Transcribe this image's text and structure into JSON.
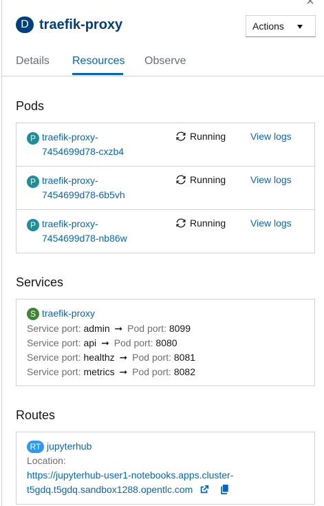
{
  "header": {
    "badge": "D",
    "title": "traefik-proxy",
    "actions_label": "Actions",
    "close_glyph": "×"
  },
  "tabs": [
    {
      "label": "Details",
      "active": false
    },
    {
      "label": "Resources",
      "active": true
    },
    {
      "label": "Observe",
      "active": false
    }
  ],
  "pods": {
    "title": "Pods",
    "items": [
      {
        "badge": "P",
        "name_line1": "traefik-proxy-",
        "name_line2": "7454699d78-cxzb4",
        "status": "Running",
        "logs": "View logs"
      },
      {
        "badge": "P",
        "name_line1": "traefik-proxy-",
        "name_line2": "7454699d78-6b5vh",
        "status": "Running",
        "logs": "View logs"
      },
      {
        "badge": "P",
        "name_line1": "traefik-proxy-",
        "name_line2": "7454699d78-nb86w",
        "status": "Running",
        "logs": "View logs"
      }
    ]
  },
  "services": {
    "title": "Services",
    "badge": "S",
    "name": "traefik-proxy",
    "service_port_label": "Service port:",
    "pod_port_label": "Pod port:",
    "ports": [
      {
        "service": "admin",
        "pod": "8099"
      },
      {
        "service": "api",
        "pod": "8080"
      },
      {
        "service": "healthz",
        "pod": "8081"
      },
      {
        "service": "metrics",
        "pod": "8082"
      }
    ]
  },
  "routes": {
    "title": "Routes",
    "badge": "RT",
    "name": "jupyterhub",
    "location_label": "Location:",
    "url_line1": "https://jupyterhub-user1-notebooks.apps.cluster-",
    "url_line2": "t5gdq.t5gdq.sandbox1288.opentlc.com"
  },
  "colors": {
    "accent": "#0066cc",
    "pod_badge": "#1e8f99",
    "service_badge": "#3e8635",
    "route_badge": "#2b9af3",
    "deployment_badge": "#004080"
  }
}
